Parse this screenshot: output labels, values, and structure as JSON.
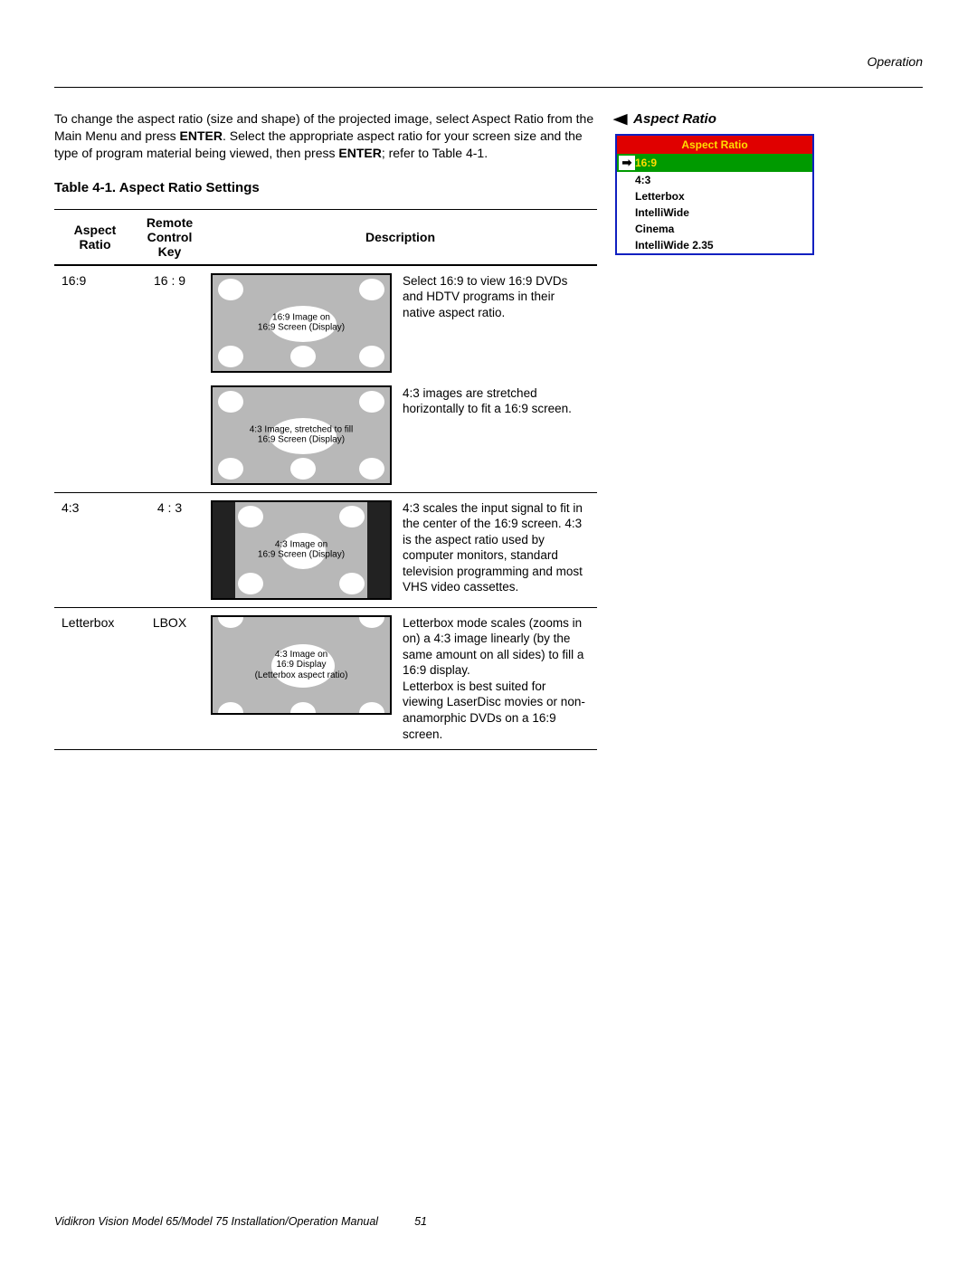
{
  "header": {
    "section": "Operation"
  },
  "intro": {
    "text_before_enter1": "To change the aspect ratio (size and shape) of the projected image, select Aspect Ratio from the Main Menu and press ",
    "enter1": "ENTER",
    "text_mid": ". Select the appropriate aspect ratio for your screen size and the type of program material being viewed, then press ",
    "enter2": "ENTER",
    "text_after": "; refer to Table 4-1."
  },
  "table_title": "Table 4-1. Aspect Ratio Settings",
  "side_heading": "Aspect Ratio",
  "osd": {
    "title": "Aspect Ratio",
    "items": [
      {
        "label": "16:9",
        "selected": true
      },
      {
        "label": "4:3",
        "selected": false
      },
      {
        "label": "Letterbox",
        "selected": false
      },
      {
        "label": "IntelliWide",
        "selected": false
      },
      {
        "label": "Cinema",
        "selected": false
      },
      {
        "label": "IntelliWide 2.35",
        "selected": false
      }
    ]
  },
  "table": {
    "headers": {
      "ar": "Aspect Ratio",
      "key": "Remote Control Key",
      "desc": "Description"
    },
    "rows": [
      {
        "ar": "16:9",
        "key": "16 : 9",
        "blocks": [
          {
            "caption": "16:9 Image on\n16:9 Screen (Display)",
            "text": "Select 16:9 to view 16:9 DVDs and HDTV programs in their native aspect ratio.",
            "variant": "wide"
          },
          {
            "caption": "4:3 Image, stretched to fill\n16:9 Screen (Display)",
            "text": "4:3 images are stretched horizontally to fit a 16:9 screen.",
            "variant": "wide"
          }
        ]
      },
      {
        "ar": "4:3",
        "key": "4 : 3",
        "blocks": [
          {
            "caption": "4:3 Image on\n16:9 Screen (Display)",
            "text": "4:3 scales the input signal to fit in the center of the 16:9 screen. 4:3 is the aspect ratio used by computer monitors, standard television programming and most VHS video cassettes.",
            "variant": "pillared"
          }
        ]
      },
      {
        "ar": "Letterbox",
        "key": "LBOX",
        "blocks": [
          {
            "caption": "4:3 Image on\n16:9 Display\n(Letterbox aspect ratio)",
            "text": "Letterbox mode scales (zooms in on) a 4:3 image linearly (by the same amount on all sides) to fill a 16:9 display.\nLetterbox is best suited for viewing LaserDisc movies or non-anamorphic DVDs on a 16:9 screen.",
            "variant": "letterbox"
          }
        ]
      }
    ]
  },
  "footer": {
    "title": "Vidikron Vision Model 65/Model 75 Installation/Operation Manual",
    "page": "51"
  }
}
